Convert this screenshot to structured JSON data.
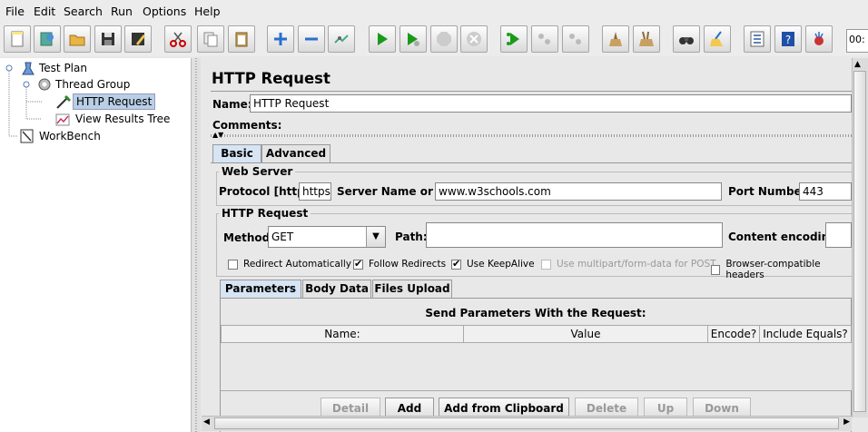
{
  "menu": [
    "File",
    "Edit",
    "Search",
    "Run",
    "Options",
    "Help"
  ],
  "toolbar": {
    "icons": [
      "new-icon",
      "templates-icon",
      "open-icon",
      "save-icon",
      "save-as-icon",
      "cut-icon",
      "copy-icon",
      "paste-icon",
      "expand-icon",
      "collapse-icon",
      "toggle-icon",
      "start-icon",
      "start-no-pause-icon",
      "stop-icon",
      "shutdown-icon",
      "remote-start-icon",
      "remote-stop-icon",
      "remote-shutdown-icon",
      "clear-icon",
      "clear-all-icon",
      "search-icon",
      "reset-search-icon",
      "function-helper-icon",
      "help-icon",
      "log-viewer-icon"
    ],
    "timer": "00:"
  },
  "tree": {
    "items": [
      {
        "label": "Test Plan",
        "icon": "test-plan-icon"
      },
      {
        "label": "Thread Group",
        "icon": "thread-group-icon"
      },
      {
        "label": "HTTP Request",
        "icon": "sampler-icon"
      },
      {
        "label": "View Results Tree",
        "icon": "listener-icon"
      },
      {
        "label": "WorkBench",
        "icon": "workbench-icon"
      }
    ]
  },
  "panel": {
    "title": "HTTP Request",
    "name_label": "Name:",
    "name_value": "HTTP Request",
    "comments_label": "Comments:",
    "tabs": [
      "Basic",
      "Advanced"
    ],
    "web_server": {
      "legend": "Web Server",
      "protocol_label": "Protocol [http]:",
      "protocol_value": "https",
      "server_label": "Server Name or IP:",
      "server_value": "www.w3schools.com",
      "port_label": "Port Number:",
      "port_value": "443"
    },
    "http_request": {
      "legend": "HTTP Request",
      "method_label": "Method:",
      "method_value": "GET",
      "path_label": "Path:",
      "path_value": "",
      "encoding_label": "Content encoding:",
      "checkboxes": [
        {
          "label": "Redirect Automatically",
          "checked": false,
          "disabled": false
        },
        {
          "label": "Follow Redirects",
          "checked": true,
          "disabled": false
        },
        {
          "label": "Use KeepAlive",
          "checked": true,
          "disabled": false
        },
        {
          "label": "Use multipart/form-data for POST",
          "checked": false,
          "disabled": true
        },
        {
          "label": "Browser-compatible headers",
          "checked": false,
          "disabled": false
        }
      ]
    },
    "sub_tabs": [
      "Parameters",
      "Body Data",
      "Files Upload"
    ],
    "params": {
      "heading": "Send Parameters With the Request:",
      "columns": [
        "Name:",
        "Value",
        "Encode?",
        "Include Equals?"
      ]
    },
    "buttons": [
      {
        "label": "Detail",
        "disabled": true
      },
      {
        "label": "Add",
        "disabled": false
      },
      {
        "label": "Add from Clipboard",
        "disabled": false
      },
      {
        "label": "Delete",
        "disabled": true
      },
      {
        "label": "Up",
        "disabled": true
      },
      {
        "label": "Down",
        "disabled": true
      }
    ]
  }
}
